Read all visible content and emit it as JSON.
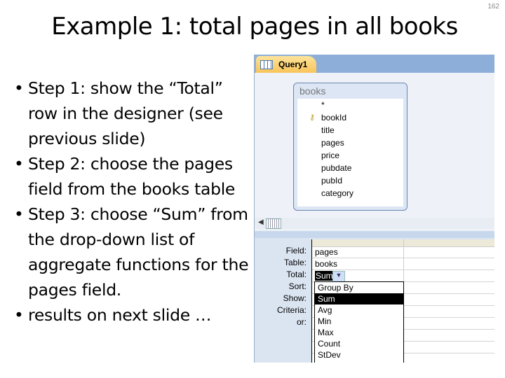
{
  "slide": {
    "title": "Example 1: total pages in all books",
    "page_number": "162",
    "bullets": [
      "Step 1: show the “Total” row in the designer (see previous slide)",
      "Step 2: choose the pages field from the books table",
      "Step 3:  choose “Sum” from the drop-down list of aggregate functions for the pages field.",
      "results on next slide …"
    ]
  },
  "query": {
    "tab": "Query1",
    "table": {
      "name": "books",
      "fields": [
        "*",
        "bookId",
        "title",
        "pages",
        "price",
        "pubdate",
        "pubId",
        "category"
      ]
    },
    "grid_labels": [
      "Field:",
      "Table:",
      "Total:",
      "Sort:",
      "Show:",
      "Criteria:",
      "or:"
    ],
    "field": "pages",
    "table_value": "books",
    "total": "Sum",
    "dropdown": [
      "Group By",
      "Sum",
      "Avg",
      "Min",
      "Max",
      "Count",
      "StDev"
    ],
    "selected_index": 1
  }
}
